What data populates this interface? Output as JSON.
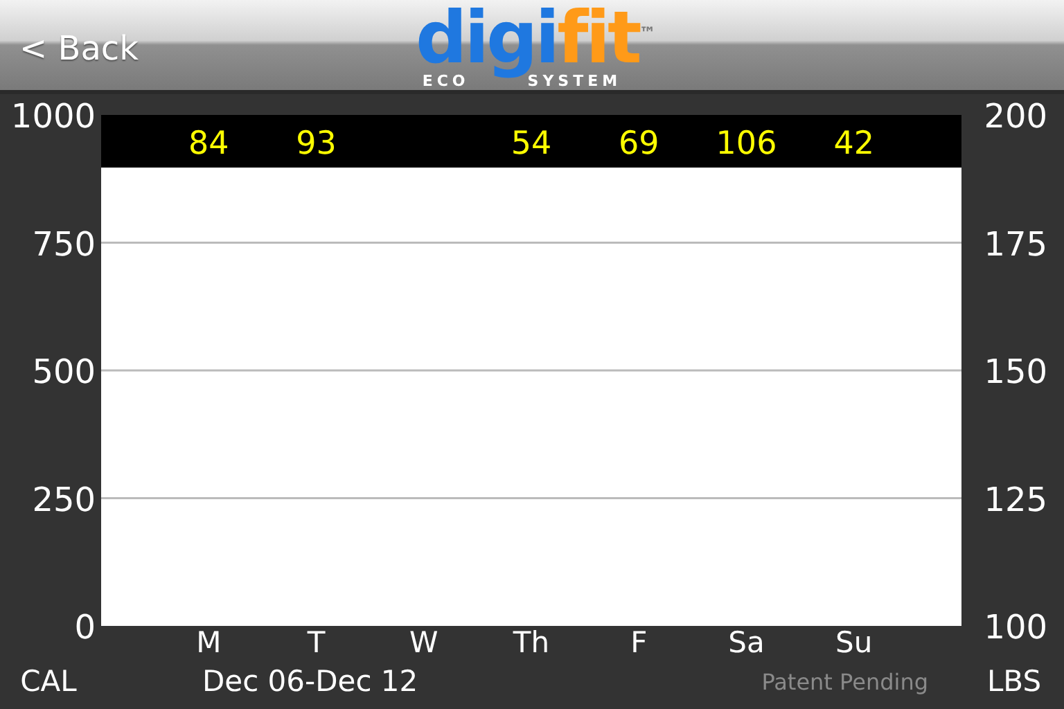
{
  "header": {
    "back_button": "< Back",
    "logo": {
      "blue_part": "digi",
      "orange_part": "fit",
      "trademark": "™",
      "tagline_left": "ECO",
      "tagline_right": "SYSTEM"
    }
  },
  "chart": {
    "left_axis_ticks": [
      "1000",
      "750",
      "500",
      "250",
      "0"
    ],
    "right_axis_ticks": [
      "200",
      "175",
      "150",
      "125",
      "100"
    ],
    "days": [
      {
        "label": "M",
        "weight": "84"
      },
      {
        "label": "T",
        "weight": "93"
      },
      {
        "label": "W"
      },
      {
        "label": "Th",
        "weight": "54"
      },
      {
        "label": "F",
        "weight": "69"
      },
      {
        "label": "Sa",
        "weight": "106"
      },
      {
        "label": "Su",
        "weight": "42"
      }
    ],
    "left_unit": "CAL",
    "right_unit": "LBS",
    "date_range": "Dec 06-Dec 12",
    "notice": "Patent Pending"
  }
}
